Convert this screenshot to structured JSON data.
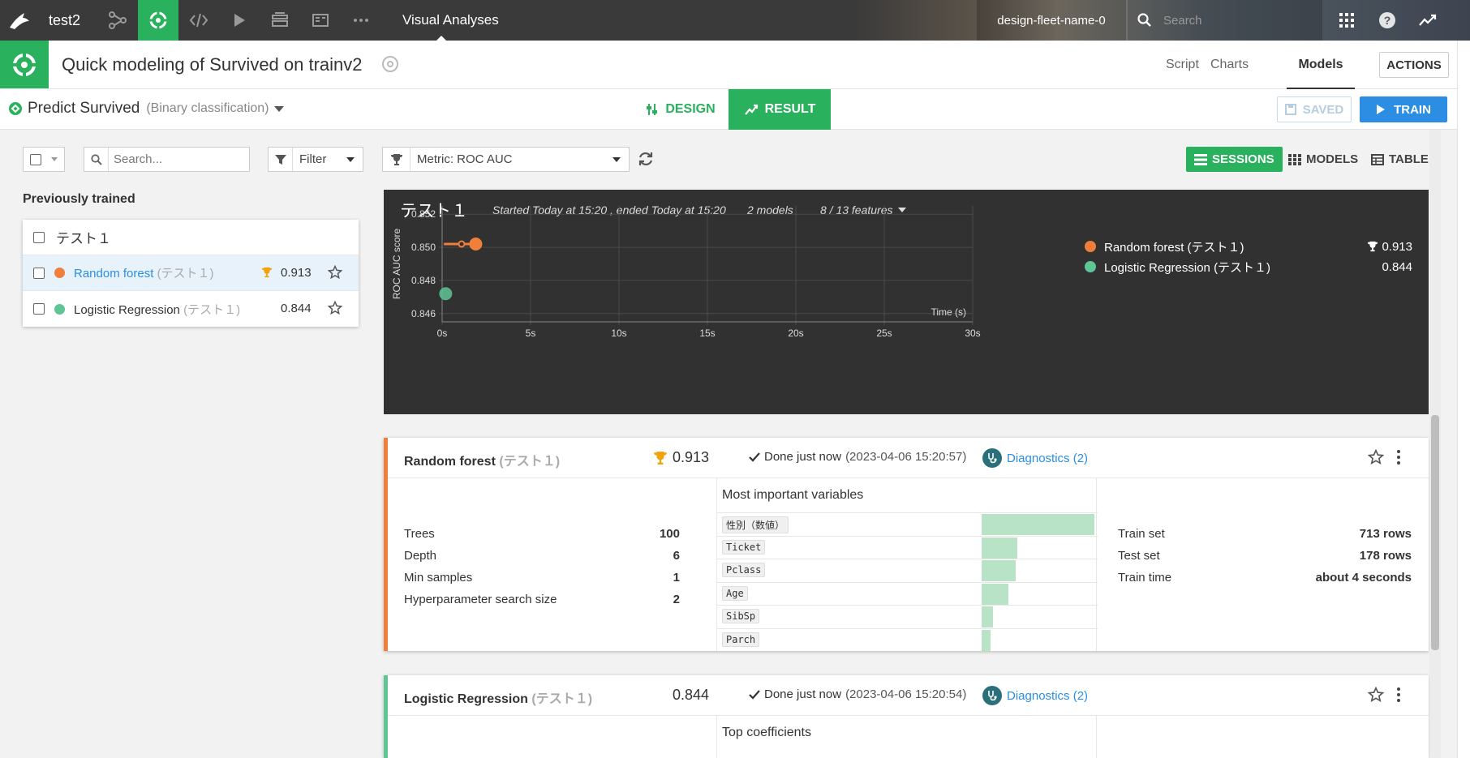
{
  "topbar": {
    "project": "test2",
    "section": "Visual Analyses",
    "fleet": "design-fleet-name-0",
    "search_placeholder": "Search"
  },
  "header": {
    "title": "Quick modeling of Survived on trainv2",
    "tabs": [
      {
        "label": "Script"
      },
      {
        "label": "Charts"
      },
      {
        "label": "Models"
      }
    ],
    "actions_label": "ACTIONS"
  },
  "taskbar": {
    "predict": "Predict Survived",
    "subtype": "(Binary classification)",
    "design_label": "DESIGN",
    "result_label": "RESULT",
    "saved_label": "SAVED",
    "train_label": "TRAIN"
  },
  "filters": {
    "search_placeholder": "Search...",
    "filter_label": "Filter",
    "metric_label": "Metric: ROC AUC",
    "views": [
      {
        "label": "SESSIONS"
      },
      {
        "label": "MODELS"
      },
      {
        "label": "TABLE"
      }
    ]
  },
  "left": {
    "title": "Previously trained",
    "group": "テスト１",
    "models": [
      {
        "name": "Random forest",
        "session": "(テスト１)",
        "score": "0.913",
        "color": "#f07f3c",
        "best": true
      },
      {
        "name": "Logistic Regression",
        "session": "(テスト１)",
        "score": "0.844",
        "color": "#5fc594",
        "best": false
      }
    ]
  },
  "session": {
    "name": "テスト１",
    "started": "Started Today at 15:20 , ended Today at 15:20",
    "models_count": "2 models",
    "features": "8 / 13 features",
    "legend": [
      {
        "label": "Random forest (テスト１)",
        "value": "0.913",
        "color": "#f07f3c"
      },
      {
        "label": "Logistic Regression (テスト１)",
        "value": "0.844",
        "color": "#5fc594"
      }
    ]
  },
  "chart_data": {
    "type": "scatter",
    "ylabel": "ROC AUC score",
    "xlabel": "Time (s)",
    "xlim": [
      0,
      30
    ],
    "ylim": [
      0.8455,
      0.8525
    ],
    "x_ticks": [
      "0s",
      "5s",
      "10s",
      "15s",
      "20s",
      "25s",
      "30s"
    ],
    "y_ticks": [
      "0.852",
      "0.850",
      "0.848",
      "0.846"
    ],
    "grid": true,
    "series": [
      {
        "name": "Random forest (テスト１)",
        "color": "#f07f3c",
        "points": [
          {
            "x": 0.1,
            "y": 0.8502
          },
          {
            "x": 1.1,
            "y": 0.8502
          },
          {
            "x": 1.9,
            "y": 0.8502
          }
        ]
      },
      {
        "name": "Logistic Regression (テスト１)",
        "color": "#5fc594",
        "points": [
          {
            "x": 0.2,
            "y": 0.8472
          }
        ]
      }
    ]
  },
  "cards": [
    {
      "name": "Random forest",
      "session": "(テスト１)",
      "score": "0.913",
      "best": true,
      "color": "#f07f3c",
      "done": "Done just now",
      "timestamp": "(2023-04-06 15:20:57)",
      "diagnostics": "Diagnostics (2)",
      "params": [
        {
          "label": "Trees",
          "value": "100"
        },
        {
          "label": "Depth",
          "value": "6"
        },
        {
          "label": "Min samples",
          "value": "1"
        },
        {
          "label": "Hyperparameter search size",
          "value": "2"
        }
      ],
      "vars_title": "Most important variables",
      "variables": [
        {
          "name": "性別（数値）",
          "importance": 1.0
        },
        {
          "name": "Ticket",
          "importance": 0.32
        },
        {
          "name": "Pclass",
          "importance": 0.3
        },
        {
          "name": "Age",
          "importance": 0.24
        },
        {
          "name": "SibSp",
          "importance": 0.1
        },
        {
          "name": "Parch",
          "importance": 0.08
        }
      ],
      "stats": [
        {
          "label": "Train set",
          "value": "713 rows"
        },
        {
          "label": "Test set",
          "value": "178 rows"
        },
        {
          "label": "Train time",
          "value": "about 4 seconds"
        }
      ]
    },
    {
      "name": "Logistic Regression",
      "session": "(テスト１)",
      "score": "0.844",
      "best": false,
      "color": "#5fc594",
      "done": "Done just now",
      "timestamp": "(2023-04-06 15:20:54)",
      "diagnostics": "Diagnostics (2)",
      "vars_title": "Top coefficients"
    }
  ]
}
